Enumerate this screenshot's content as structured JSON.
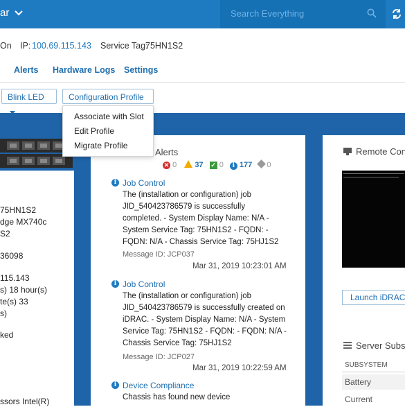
{
  "header": {
    "left_text": "ar",
    "search_placeholder": "Search Everything"
  },
  "info_row": {
    "power": "On",
    "ip_label": "IP:",
    "ip_value": "100.69.115.143",
    "service_tag_label": "Service Tag:",
    "service_tag_value": "75HN1S2"
  },
  "tabs": [
    "Alerts",
    "Hardware Logs",
    "Settings"
  ],
  "toolbar": {
    "blink_led": "Blink LED",
    "config_profile": "Configuration Profile"
  },
  "dropdown": {
    "items": [
      "Associate with Slot",
      "Edit Profile",
      "Migrate Profile"
    ]
  },
  "left_panel": {
    "lines": [
      "75HN1S2",
      "dge MX740c",
      "S2",
      "36098",
      "115.143",
      "s) 18 hour(s)",
      "te(s) 33",
      "s)",
      "ked",
      "ssors Intel(R)"
    ]
  },
  "alerts": {
    "title": "Alerts",
    "counts": {
      "critical": "0",
      "warning": "37",
      "ok": "0",
      "info": "177",
      "unknown": "0"
    },
    "items": [
      {
        "title": "Job Control",
        "lines": [
          "The (installation or configuration) job",
          "JID_540423786579 is successfully",
          "completed. - System Display Name: N/A -",
          "System Service Tag: 75HN1S2 - FQDN: -",
          "FQDN: N/A - Chassis Service Tag: 75HJ1S2"
        ],
        "message_id": "Message ID: JCP037",
        "date": "Mar 31, 2019 10:23:01 AM"
      },
      {
        "title": "Job Control",
        "lines": [
          "The (installation or configuration) job",
          "JID_540423786579 is successfully created on",
          "iDRAC. - System Display Name: N/A - System",
          "Service Tag: 75HN1S2 - FQDN: - FQDN: N/A -",
          "Chassis Service Tag: 75HJ1S2"
        ],
        "message_id": "Message ID: JCP027",
        "date": "Mar 31, 2019 10:22:59 AM"
      },
      {
        "title": "Device Compliance",
        "lines": [
          "Chassis has found new device"
        ]
      }
    ]
  },
  "right_panel": {
    "remote_title": "Remote Con",
    "launch_btn": "Launch iDRAC",
    "server_title": "Server Subs",
    "table_header": "SUBSYSTEM",
    "rows": [
      "Battery",
      "Current"
    ]
  },
  "colors": {
    "accent": "#1f7bc1",
    "band": "#1f64a8"
  }
}
